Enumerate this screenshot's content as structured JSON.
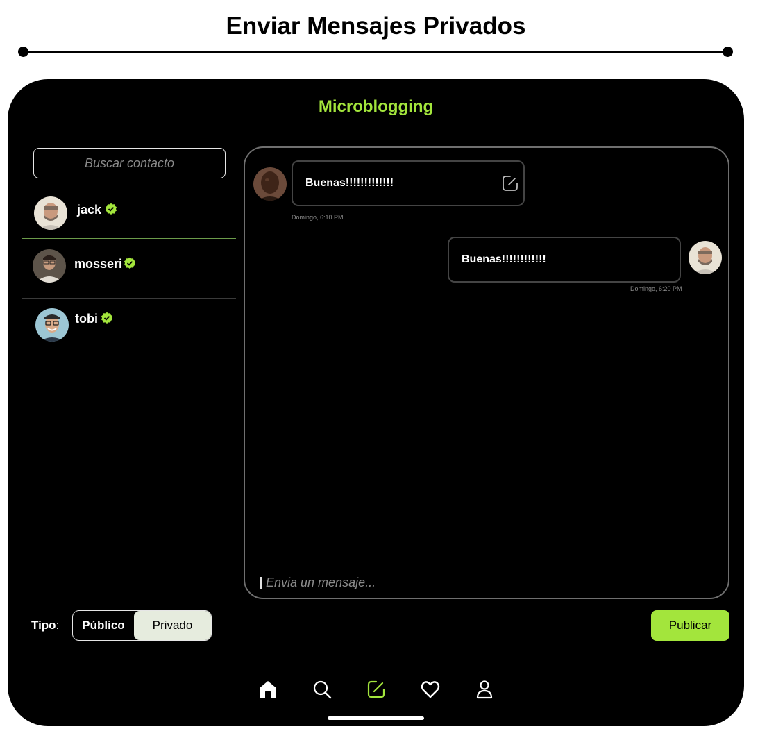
{
  "page": {
    "title": "Enviar Mensajes Privados"
  },
  "app": {
    "title": "Microblogging"
  },
  "search": {
    "placeholder": "Buscar contacto"
  },
  "contacts": [
    {
      "name": "jack",
      "verified": true,
      "active": true
    },
    {
      "name": "mosseri",
      "verified": true,
      "active": false
    },
    {
      "name": "tobi",
      "verified": true,
      "active": false
    }
  ],
  "messages": [
    {
      "direction": "incoming",
      "text": "Buenas!!!!!!!!!!!!!",
      "time": "Domingo, 6:10 PM"
    },
    {
      "direction": "outgoing",
      "text": "Buenas!!!!!!!!!!!!",
      "time": "Domingo, 6:20 PM"
    }
  ],
  "composer": {
    "placeholder": "Envia un mensaje..."
  },
  "post_type": {
    "label": "Tipo",
    "separator": ":",
    "options": [
      "Público",
      "Privado"
    ],
    "selected": "Privado"
  },
  "actions": {
    "publish": "Publicar"
  },
  "nav": {
    "items": [
      "home-icon",
      "search-icon",
      "compose-icon",
      "heart-icon",
      "profile-icon"
    ],
    "active": "compose-icon"
  },
  "colors": {
    "accent": "#a3e53c",
    "background": "#000000",
    "segment_selected": "#e6ecde"
  }
}
